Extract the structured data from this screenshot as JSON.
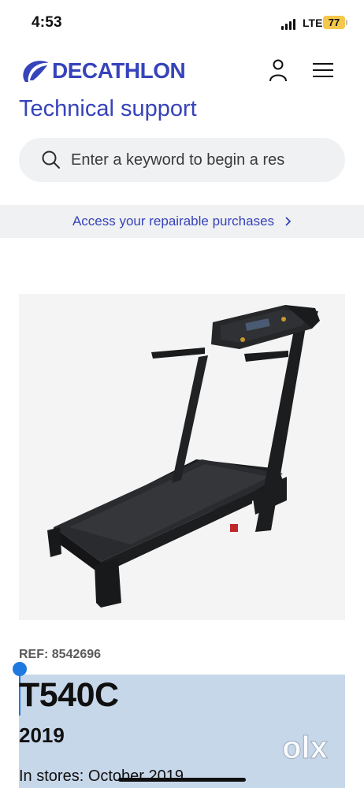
{
  "status_bar": {
    "time": "4:53",
    "network": "LTE",
    "battery": "77"
  },
  "header": {
    "brand": "DECATHLON",
    "account_icon": "user-icon",
    "menu_icon": "hamburger-icon"
  },
  "page": {
    "title": "Technical support"
  },
  "search": {
    "placeholder": "Enter a keyword to begin a res",
    "icon": "search-icon"
  },
  "repair_banner": {
    "label": "Access your repairable purchases"
  },
  "product": {
    "image": "treadmill",
    "ref": "REF: 8542696",
    "model": "T540C",
    "year": "2019",
    "in_stores": "In stores: October 2019"
  },
  "watermark": {
    "text": "olx"
  },
  "colors": {
    "brand": "#3643ba",
    "banner_bg": "#f0f1f2",
    "search_bg": "#eff1f3",
    "selection": "#c7d7ea",
    "battery": "#f5c84b"
  }
}
